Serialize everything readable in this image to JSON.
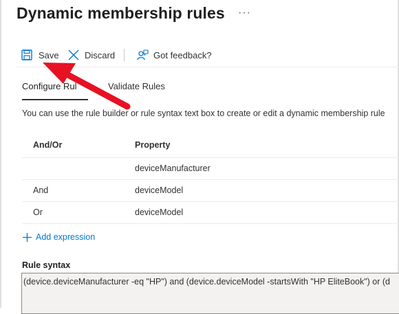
{
  "page": {
    "title": "Dynamic membership rules",
    "more_glyph": "···"
  },
  "toolbar": {
    "save_label": "Save",
    "discard_label": "Discard",
    "feedback_label": "Got feedback?"
  },
  "tabs": [
    {
      "label": "Configure Rules",
      "visible_label": "Configure Rul",
      "selected": true
    },
    {
      "label": "Validate Rules",
      "selected": false
    }
  ],
  "description": "You can use the rule builder or rule syntax text box to create or edit a dynamic membership rule",
  "rules_table": {
    "headers": {
      "and_or": "And/Or",
      "property": "Property"
    },
    "rows": [
      {
        "and_or": "",
        "property": "deviceManufacturer"
      },
      {
        "and_or": "And",
        "property": "deviceModel"
      },
      {
        "and_or": "Or",
        "property": "deviceModel"
      }
    ]
  },
  "add_expression": {
    "label": "Add expression",
    "icon": "plus-icon"
  },
  "rule_syntax": {
    "label": "Rule syntax",
    "value": "(device.deviceManufacturer -eq \"HP\") and (device.deviceModel -startsWith \"HP EliteBook\") or (d"
  },
  "annotation": {
    "type": "arrow",
    "color": "#e81123",
    "points_to": "save-button"
  },
  "colors": {
    "accent": "#0078d4",
    "arrow": "#e81123",
    "text": "#323130"
  }
}
